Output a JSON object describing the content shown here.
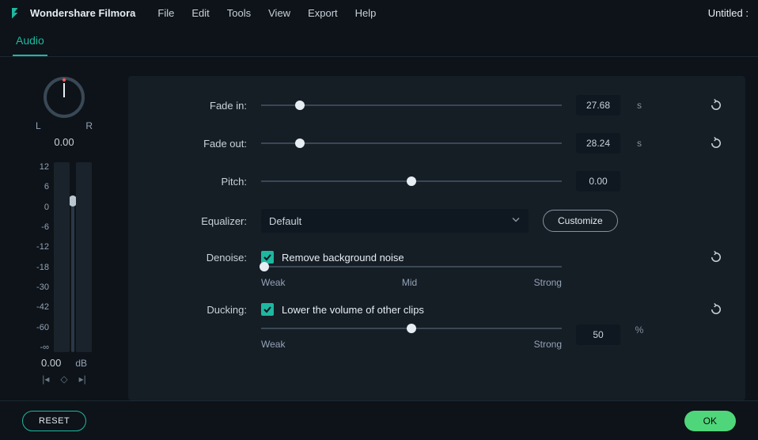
{
  "app": {
    "name": "Wondershare Filmora",
    "doc_title": "Untitled :"
  },
  "menu": [
    "File",
    "Edit",
    "Tools",
    "View",
    "Export",
    "Help"
  ],
  "tab": {
    "active": "Audio"
  },
  "balance": {
    "left_label": "L",
    "right_label": "R",
    "value": "0.00"
  },
  "meter": {
    "ticks": [
      "12",
      "6",
      "0",
      "-6",
      "-12",
      "-18",
      "-30",
      "-42",
      "-60",
      "-∞"
    ],
    "db_value": "0.00",
    "db_label": "dB"
  },
  "settings": {
    "fade_in": {
      "label": "Fade in:",
      "value": "27.68",
      "unit": "s",
      "pos": 13
    },
    "fade_out": {
      "label": "Fade out:",
      "value": "28.24",
      "unit": "s",
      "pos": 13
    },
    "pitch": {
      "label": "Pitch:",
      "value": "0.00",
      "pos": 50
    },
    "equalizer": {
      "label": "Equalizer:",
      "value": "Default",
      "customize": "Customize"
    },
    "denoise": {
      "label": "Denoise:",
      "cb_label": "Remove background noise",
      "pos": 1,
      "scale": {
        "min": "Weak",
        "mid": "Mid",
        "max": "Strong"
      }
    },
    "ducking": {
      "label": "Ducking:",
      "cb_label": "Lower the volume of other clips",
      "value": "50",
      "unit": "%",
      "pos": 50,
      "scale": {
        "min": "Weak",
        "max": "Strong"
      }
    }
  },
  "footer": {
    "reset": "RESET",
    "ok": "OK"
  }
}
